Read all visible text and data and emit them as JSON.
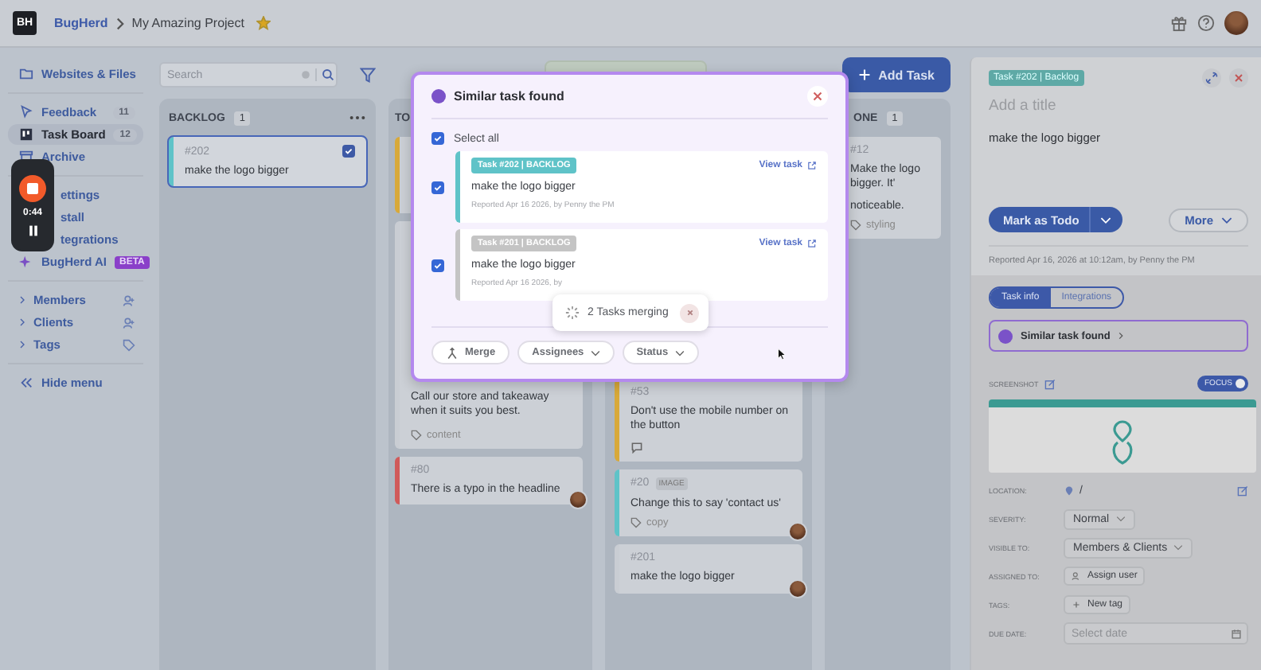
{
  "top_bar": {
    "logo": "BH",
    "breadcrumb": [
      {
        "label": "BugHerd"
      },
      {
        "label": "My Amazing Project"
      }
    ],
    "starred": true
  },
  "sidebar": {
    "websites": "Websites & Files",
    "main": [
      {
        "label": "Feedback",
        "kind": "feedback",
        "count": "11",
        "selected": false
      },
      {
        "label": "Task Board",
        "kind": "board",
        "count": "12",
        "selected": true
      },
      {
        "label": "Archive",
        "kind": "archive",
        "selected": false
      }
    ],
    "tools": [
      {
        "label": "ettings",
        "kind": "partial"
      },
      {
        "label": "stall",
        "kind": "partial"
      },
      {
        "label": "tegrations",
        "kind": "partial"
      },
      {
        "label": "BugHerd AI",
        "kind": "ai",
        "badge": "BETA"
      }
    ],
    "people": [
      {
        "label": "Members",
        "kind": "person"
      },
      {
        "label": "Clients",
        "kind": "person"
      },
      {
        "label": "Tags",
        "kind": "tag"
      }
    ],
    "hide": "Hide menu"
  },
  "recorder": {
    "time": "0:44"
  },
  "board": {
    "search": {
      "placeholder": "Search"
    },
    "add_task": "Add Task",
    "columns": [
      {
        "title": "BACKLOG",
        "count": "1",
        "cards": [
          {
            "kind": "full",
            "number": "#202",
            "lines": [
              "make the logo bigger"
            ],
            "color": "#5fc3c8",
            "selected": true
          }
        ]
      },
      {
        "title": "TO",
        "cards": [
          {
            "kind": "blank",
            "color": "#d8a93a"
          },
          {
            "kind": "tail",
            "lines": [
              "Call our store and takeaway when it suits you best."
            ],
            "tag": "content",
            "color": "#c9cdd3",
            "selected": false
          },
          {
            "kind": "full",
            "number": "#80",
            "lines": [
              "There is a typo in the headline"
            ],
            "color": "#d05a5a",
            "avatar": true,
            "selected": false
          }
        ]
      },
      {
        "cards": [
          {
            "kind": "full",
            "number": "#53",
            "lines": [
              "Don't use the mobile number on the button"
            ],
            "color": "#d8a93a",
            "comments": true,
            "selected": false
          },
          {
            "kind": "full",
            "number": "#20",
            "badge": "IMAGE",
            "lines": [
              "Change this to say 'contact us'"
            ],
            "tag": "copy",
            "color": "#5fc3c8",
            "avatar": true,
            "selected": false
          },
          {
            "kind": "full",
            "number": "#201",
            "lines": [
              "make the logo bigger"
            ],
            "color": "#c9cdd3",
            "avatar": true,
            "selected": false
          }
        ]
      },
      {
        "title": "ONE",
        "count": "1",
        "cards": [
          {
            "kind": "full",
            "number": "#12",
            "lines": [
              "Make the logo bigger. It'",
              "noticeable."
            ],
            "tag": "styling",
            "color": "#c9cdd3",
            "selected": false
          }
        ]
      }
    ]
  },
  "modal": {
    "title": "Similar task found",
    "select_all": {
      "label": "Select all",
      "checked": true
    },
    "tasks": [
      {
        "badge": "Task #202 | BACKLOG",
        "color": "#5fc3c8",
        "checked": true,
        "link": "View task",
        "text": "make the logo bigger",
        "reported": "Reported Apr 16 2026, by Penny the PM"
      },
      {
        "badge": "Task #201 | BACKLOG",
        "color": "#c4c4c4",
        "checked": true,
        "link": "View task",
        "text": "make the logo bigger",
        "reported": "Reported Apr 16 2026, by"
      }
    ],
    "actions": [
      {
        "label": "Merge",
        "kind": "merge"
      },
      {
        "label": "Assignees",
        "kind": "dropdown"
      },
      {
        "label": "Status",
        "kind": "dropdown"
      }
    ]
  },
  "toast": {
    "label": "2 Tasks merging"
  },
  "task_panel": {
    "badge": "Task #202 | Backlog",
    "title": {
      "placeholder": "Add a title"
    },
    "description": "make the logo bigger",
    "status_button": "Mark as Todo",
    "more_button": "More",
    "reported": "Reported Apr 16, 2026 at 10:12am, by Penny the PM",
    "tabs": [
      {
        "label": "Task info",
        "selected": true
      },
      {
        "label": "Integrations",
        "selected": false
      }
    ],
    "similar": "Similar task found",
    "screenshot_label": "SCREENSHOT",
    "focus": {
      "label": "FOCUS",
      "on": true
    },
    "fields": [
      {
        "label": "LOCATION:",
        "kind": "location",
        "value": "/"
      },
      {
        "label": "SEVERITY:",
        "kind": "select",
        "value": "Normal"
      },
      {
        "label": "VISIBLE TO:",
        "kind": "select",
        "value": "Members & Clients"
      },
      {
        "label": "ASSIGNED TO:",
        "kind": "assign",
        "value": "Assign user"
      },
      {
        "label": "TAGS:",
        "kind": "tag",
        "value": "New tag"
      },
      {
        "label": "DUE DATE:",
        "kind": "date",
        "placeholder": "Select date"
      }
    ]
  }
}
